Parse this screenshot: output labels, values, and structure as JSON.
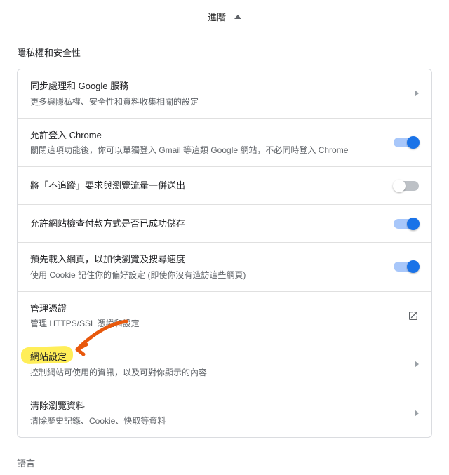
{
  "header": {
    "advanced": "進階"
  },
  "section": {
    "privacy": "隱私權和安全性",
    "language": "語言"
  },
  "rows": {
    "sync": {
      "title": "同步處理和 Google 服務",
      "sub": "更多與隱私權、安全性和資料收集相關的設定"
    },
    "allowSignin": {
      "title": "允許登入 Chrome",
      "sub": "關閉這項功能後，你可以單獨登入 Gmail 等這類 Google 網站，不必同時登入 Chrome",
      "on": true
    },
    "dnt": {
      "title": "將「不追蹤」要求與瀏覽流量一併送出",
      "on": false
    },
    "paymentCheck": {
      "title": "允許網站檢查付款方式是否已成功儲存",
      "on": true
    },
    "preload": {
      "title": "預先載入網頁，以加快瀏覽及搜尋速度",
      "sub": "使用 Cookie 記住你的偏好設定 (即使你沒有造訪這些網頁)",
      "on": true
    },
    "certs": {
      "title": "管理憑證",
      "sub": "管理 HTTPS/SSL 憑證和設定"
    },
    "siteSettings": {
      "title": "網站設定",
      "sub": "控制網站可使用的資訊，以及可對你顯示的內容"
    },
    "clearData": {
      "title": "清除瀏覽資料",
      "sub": "清除歷史記錄、Cookie、快取等資料"
    }
  }
}
